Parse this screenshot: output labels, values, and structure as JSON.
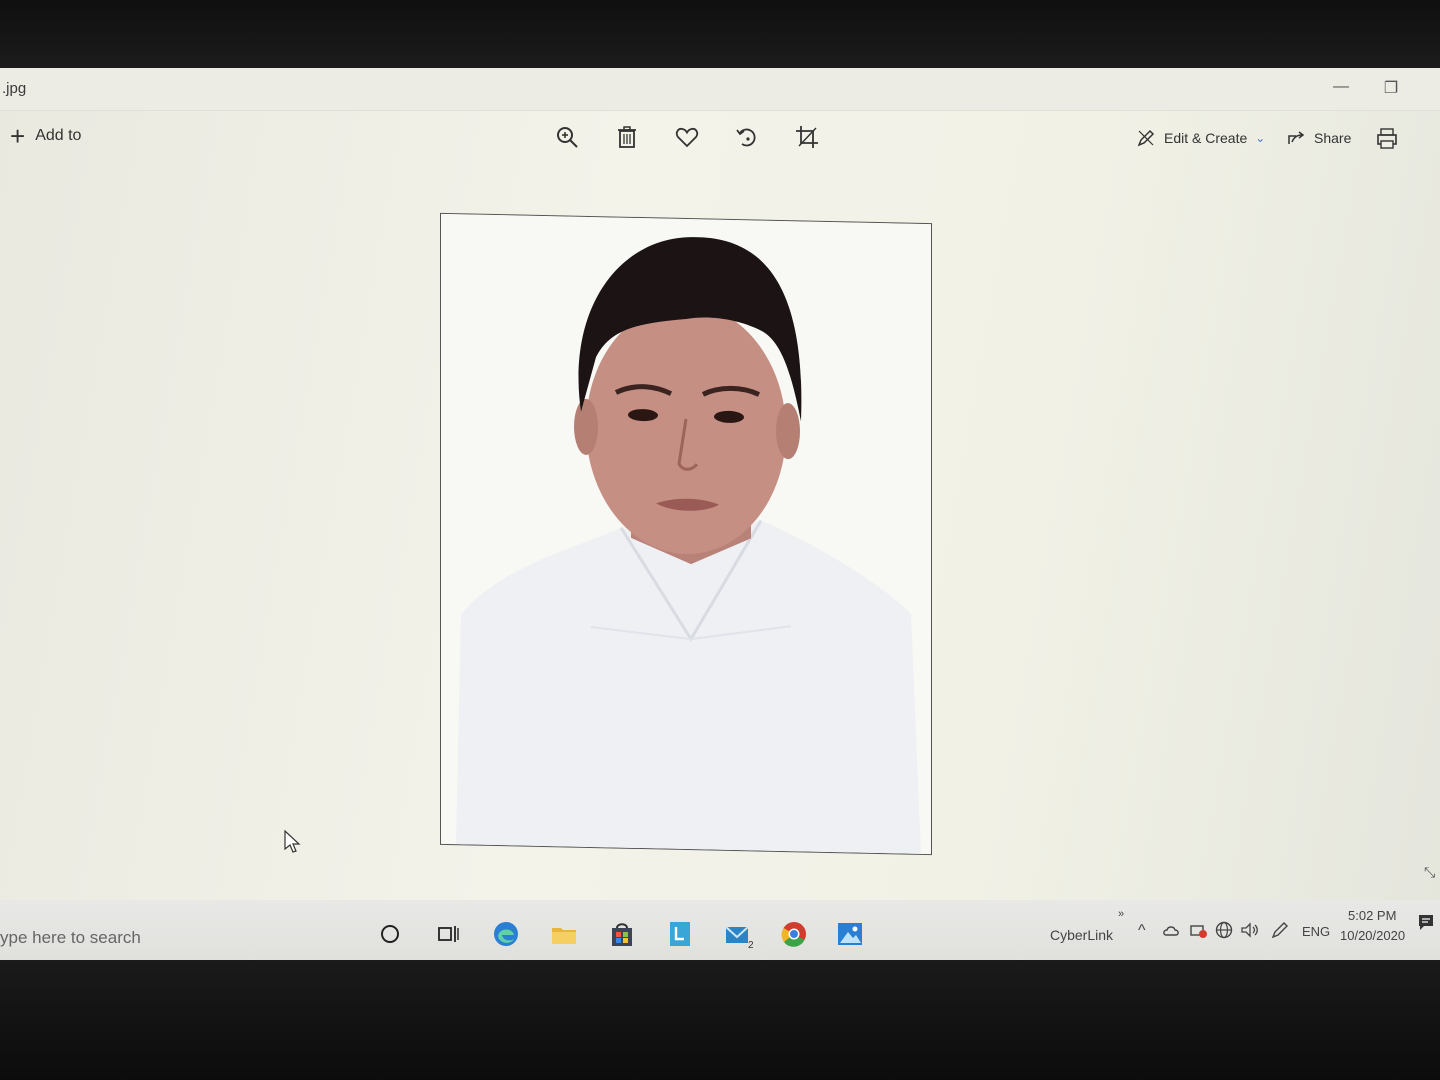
{
  "window": {
    "title": ".jpg",
    "minimize_glyph": "—",
    "restore_glyph": "❐"
  },
  "toolbar": {
    "add_to_label": "Add to",
    "icons": [
      "zoom-icon",
      "trash-icon",
      "heart-icon",
      "rotate-icon",
      "crop-icon"
    ],
    "edit_create_label": "Edit & Create",
    "share_label": "Share"
  },
  "taskbar": {
    "search_placeholder": "ype here to search",
    "tray_app_label": "CyberLink",
    "overflow_glyph": "»",
    "language": "ENG",
    "time": "5:02 PM",
    "date": "10/20/2020",
    "badge_count": "2"
  },
  "colors": {
    "accent_blue": "#2a7fd4",
    "chrome_red": "#d23c2f",
    "chrome_yellow": "#f2b526",
    "chrome_green": "#3aa346",
    "explorer_yellow": "#e8b63d"
  }
}
